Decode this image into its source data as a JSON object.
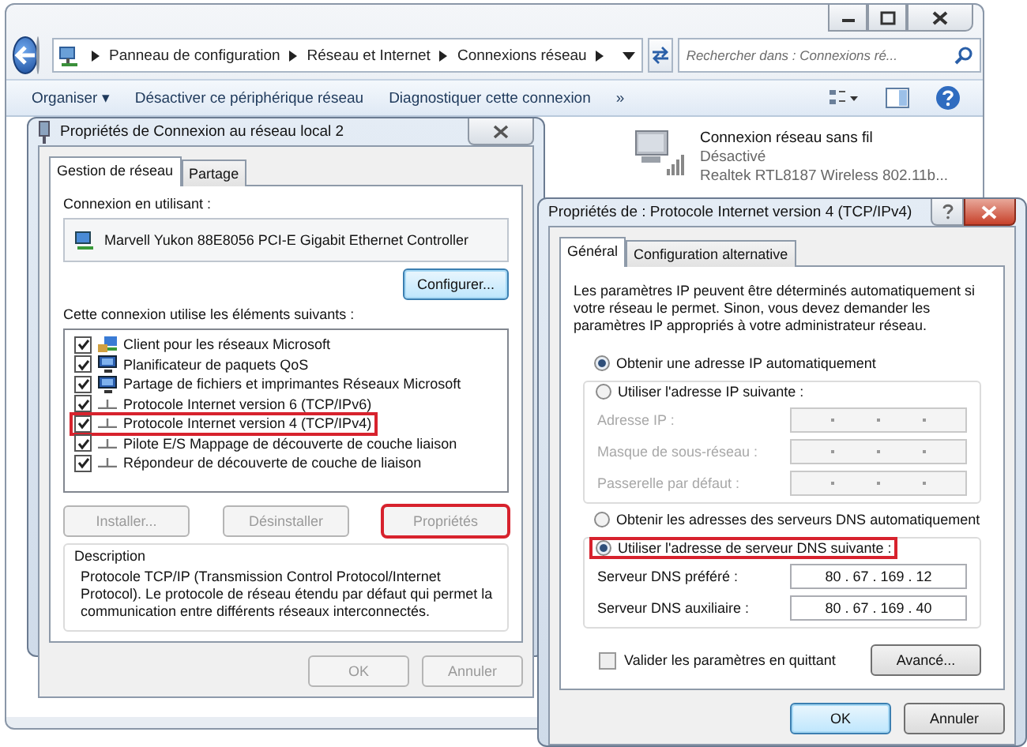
{
  "explorer": {
    "breadcrumb": [
      "Panneau de configuration",
      "Réseau et Internet",
      "Connexions réseau"
    ],
    "search": {
      "placeholder": "Rechercher dans : Connexions ré..."
    },
    "toolbar": [
      "Organiser ▾",
      "Désactiver ce périphérique réseau",
      "Diagnostiquer cette connexion",
      "»"
    ],
    "connection": {
      "name": "Connexion réseau sans fil",
      "status": "Désactivé",
      "device": "Realtek RTL8187 Wireless 802.11b..."
    }
  },
  "dialog_lan": {
    "title": "Propriétés de Connexion au réseau local 2",
    "tabs": [
      {
        "label": "Gestion de réseau",
        "selected": true
      },
      {
        "label": "Partage",
        "selected": false
      }
    ],
    "connect_using_label": "Connexion en utilisant :",
    "adapter": "Marvell Yukon 88E8056 PCI-E Gigabit Ethernet Controller",
    "configure_button": "Configurer...",
    "components_label": "Cette connexion utilise les éléments suivants :",
    "components": [
      {
        "label": "Client pour les réseaux Microsoft",
        "kind": "client",
        "checked": true,
        "highlighted": false
      },
      {
        "label": "Planificateur de paquets QoS",
        "kind": "service",
        "checked": true,
        "highlighted": false
      },
      {
        "label": "Partage de fichiers et imprimantes Réseaux Microsoft",
        "kind": "service",
        "checked": true,
        "highlighted": false
      },
      {
        "label": "Protocole Internet version 6 (TCP/IPv6)",
        "kind": "protocol",
        "checked": true,
        "highlighted": false
      },
      {
        "label": "Protocole Internet version 4 (TCP/IPv4)",
        "kind": "protocol",
        "checked": true,
        "highlighted": true
      },
      {
        "label": "Pilote E/S Mappage de découverte de couche liaison",
        "kind": "protocol",
        "checked": true,
        "highlighted": false
      },
      {
        "label": "Répondeur de découverte de couche de liaison",
        "kind": "protocol",
        "checked": true,
        "highlighted": false
      }
    ],
    "buttons": [
      {
        "label": "Installer...",
        "disabled": true,
        "highlighted": false
      },
      {
        "label": "Désinstaller",
        "disabled": true,
        "highlighted": false
      },
      {
        "label": "Propriétés",
        "disabled": true,
        "highlighted": true
      }
    ],
    "description_label": "Description",
    "description": "Protocole TCP/IP (Transmission Control Protocol/Internet Protocol). Le protocole de réseau étendu par défaut qui permet la communication entre différents réseaux interconnectés.",
    "footer_buttons": [
      {
        "label": "OK",
        "disabled": true
      },
      {
        "label": "Annuler",
        "disabled": true
      }
    ]
  },
  "dialog_ipv4": {
    "title": "Propriétés de : Protocole Internet version 4 (TCP/IPv4)",
    "tabs": [
      {
        "label": "Général",
        "selected": true
      },
      {
        "label": "Configuration alternative",
        "selected": false
      }
    ],
    "intro": "Les paramètres IP peuvent être déterminés automatiquement si votre réseau le permet. Sinon, vous devez demander les paramètres IP appropriés à votre administrateur réseau.",
    "ip_options": [
      {
        "label": "Obtenir une adresse IP automatiquement",
        "selected": true,
        "highlighted": false
      },
      {
        "label": "Utiliser l'adresse IP suivante :",
        "selected": false,
        "highlighted": false
      }
    ],
    "ip_fields": [
      {
        "label": "Adresse IP :",
        "disabled": true
      },
      {
        "label": "Masque de sous-réseau :",
        "disabled": true
      },
      {
        "label": "Passerelle par défaut :",
        "disabled": true
      }
    ],
    "dns_options": [
      {
        "label": "Obtenir les adresses des serveurs DNS automatiquement",
        "selected": false,
        "highlighted": false
      },
      {
        "label": "Utiliser l'adresse de serveur DNS suivante :",
        "selected": true,
        "highlighted": true
      }
    ],
    "dns_fields": [
      {
        "label": "Serveur DNS préféré :",
        "value": "80 . 67 . 169 . 12"
      },
      {
        "label": "Serveur DNS auxiliaire :",
        "value": "80 . 67 . 169 . 40"
      }
    ],
    "validate": {
      "label": "Valider les paramètres en quittant",
      "checked": false
    },
    "advanced_button": "Avancé...",
    "footer_buttons": [
      {
        "label": "OK",
        "disabled": false
      },
      {
        "label": "Annuler",
        "disabled": false
      }
    ]
  }
}
